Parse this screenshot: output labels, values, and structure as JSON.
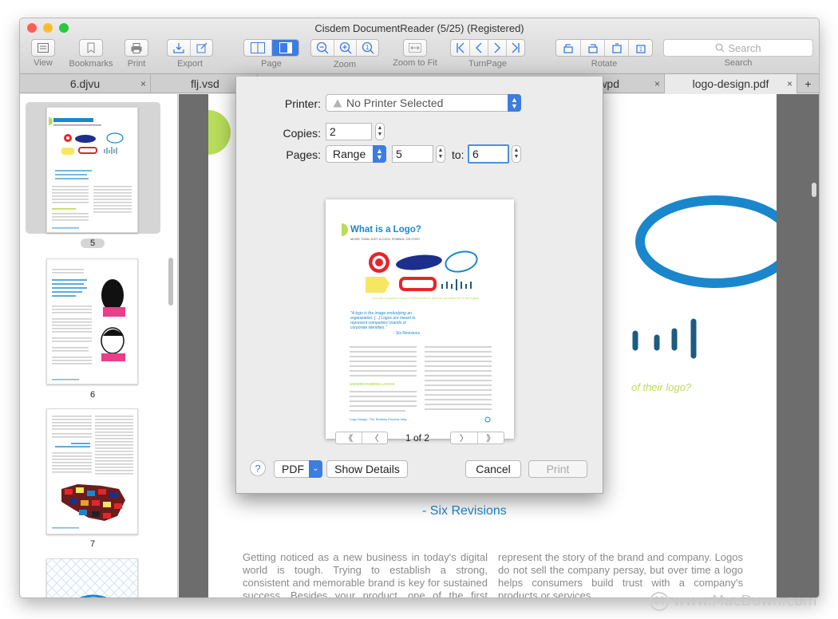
{
  "window": {
    "title": "Cisdem DocumentReader (5/25) (Registered)",
    "toolbar": {
      "view": "View",
      "bookmarks": "Bookmarks",
      "print": "Print",
      "export": "Export",
      "page": "Page",
      "zoom": "Zoom",
      "zoom_to_fit": "Zoom to Fit",
      "turnpage": "TurnPage",
      "rotate": "Rotate",
      "search_placeholder": "Search",
      "search_label": "Search"
    },
    "tabs": [
      {
        "label": "6.djvu"
      },
      {
        "label": "flj.vsd"
      },
      {
        "label": "a.wpd"
      },
      {
        "label": "logo-design.pdf"
      },
      {
        "label": "+"
      }
    ]
  },
  "sidebar": {
    "thumbnails": [
      {
        "page": "5"
      },
      {
        "page": "6"
      },
      {
        "page": "7"
      }
    ]
  },
  "print_dialog": {
    "printer_label": "Printer:",
    "printer_value": "No Printer Selected",
    "copies_label": "Copies:",
    "copies_value": "2",
    "pages_label": "Pages:",
    "pages_mode": "Range",
    "range_from": "5",
    "to_label": "to:",
    "range_to": "6",
    "preview": {
      "title": "What is a Logo?",
      "subtitle": "MORE THAN JUST A COOL SYMBOL OR FONT",
      "caption": "Can you recognize these? (Scroll down to see the complete list of the logos)",
      "quote": "\"A logo is the image embodying an organization. [...] Logos are meant to represent companies' brands or corporate identities.\"",
      "quote_source": "- Six Revisions",
      "section_heading": "UNDERSTANDING LOGOS",
      "footer": "Logo Design: The Shadow Process Way"
    },
    "pager": {
      "text": "1 of 2"
    },
    "help": "?",
    "pdf": "PDF",
    "show_details": "Show Details",
    "cancel": "Cancel",
    "print": "Print"
  },
  "document": {
    "tagline": "of their logo?",
    "quote_source": "- Six Revisions",
    "col1": "Getting noticed as a new business in today's digital world is tough. Trying to establish a strong, consistent and memorable brand is key for sustained success. Besides your product, one of the first places you should start when developing your brand is with the",
    "col2": "represent the story of the brand and company. Logos do not sell the company persay, but over time a logo helps consumers build trust with a company's products or services."
  },
  "watermark": "www.MacDown.com",
  "colors": {
    "accent": "#3d7de0",
    "logo_blue": "#1a87cc",
    "logo_green": "#b7dd5a",
    "logo_red": "#e4262a",
    "logo_navy": "#1c2f8c"
  }
}
